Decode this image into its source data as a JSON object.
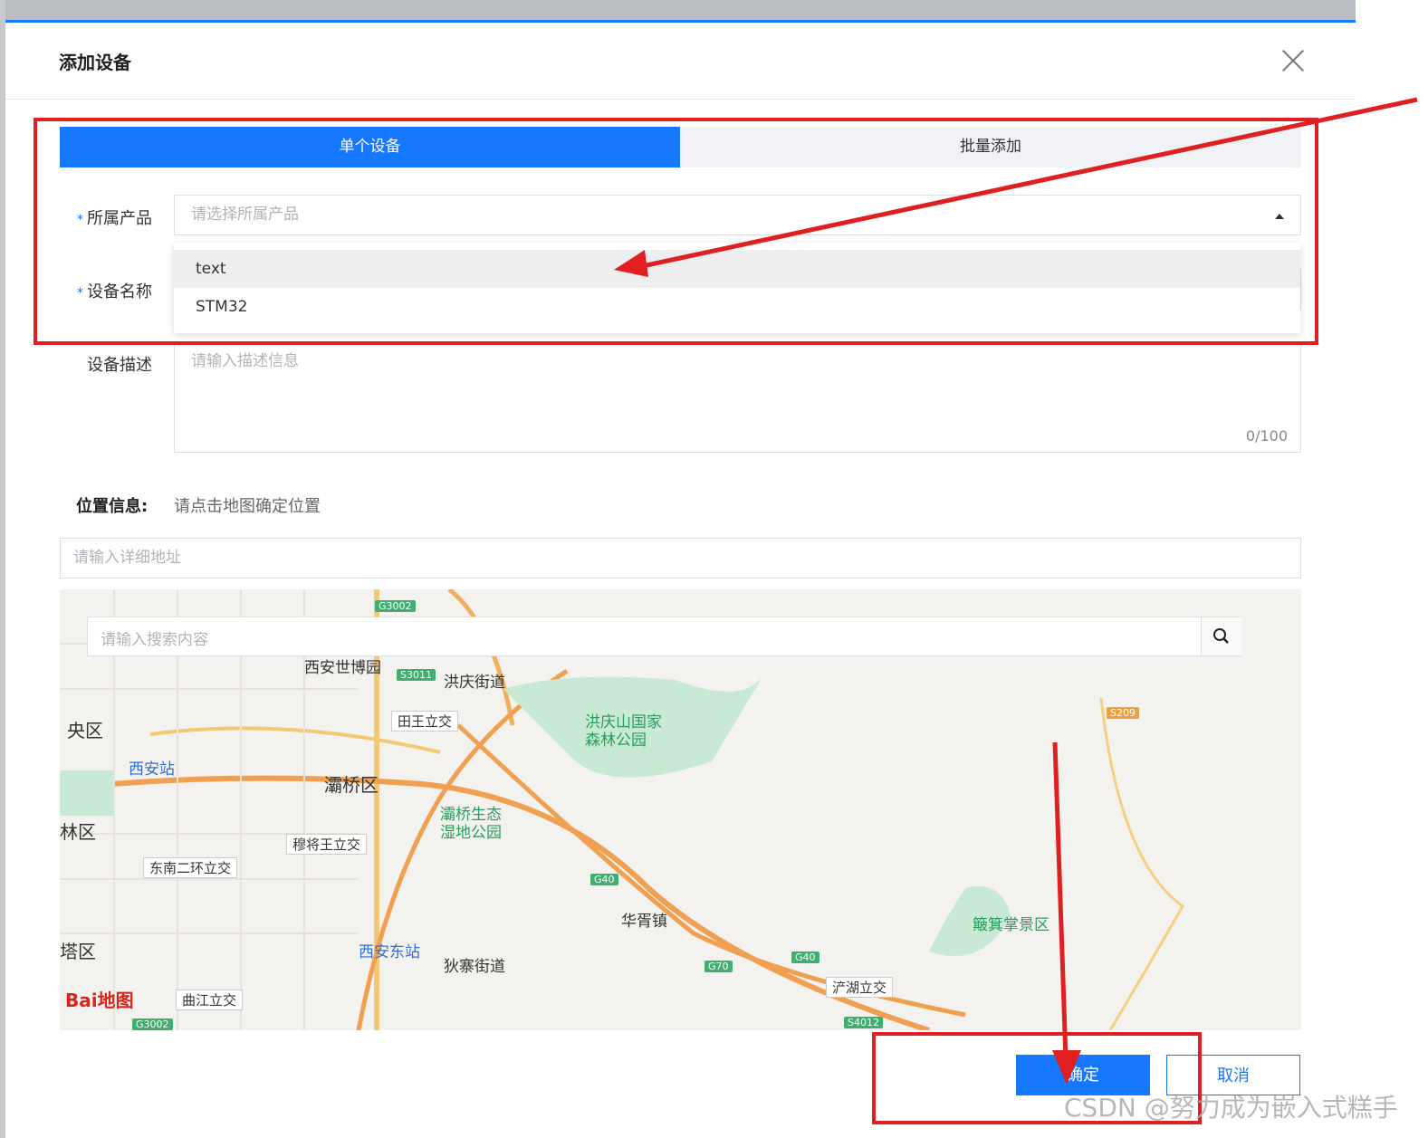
{
  "dialog": {
    "title": "添加设备"
  },
  "tabs": {
    "single": "单个设备",
    "batch": "批量添加"
  },
  "form": {
    "product": {
      "label": "所属产品",
      "placeholder": "请选择所属产品",
      "options": [
        "text",
        "STM32"
      ]
    },
    "device_name": {
      "label": "设备名称"
    },
    "description": {
      "label": "设备描述",
      "placeholder": "请输入描述信息",
      "counter": "0/100"
    }
  },
  "location": {
    "label": "位置信息:",
    "hint": "请点击地图确定位置",
    "address_placeholder": "请输入详细地址"
  },
  "map": {
    "search_placeholder": "请输入搜索内容",
    "places": [
      "西安世博园",
      "洪庆街道",
      "田王立交",
      "洪庆山国家",
      "森林公园",
      "央区",
      "西安站",
      "灞桥区",
      "灞桥生态",
      "湿地公园",
      "林区",
      "穆将王立交",
      "东南二环立交",
      "华胥镇",
      "簸箕掌景区",
      "塔区",
      "西安东站",
      "狄寨街道",
      "浐湖立交",
      "曲江立交"
    ],
    "road_badges": [
      "G3002",
      "S3011",
      "S209",
      "G40",
      "G70",
      "G40",
      "S4012",
      "G3002"
    ],
    "logo": "Bai地图"
  },
  "buttons": {
    "ok": "确定",
    "cancel": "取消"
  },
  "watermark": "CSDN @努力成为嵌入式糕手",
  "colors": {
    "primary": "#1677ff",
    "annotation": "#e02020"
  }
}
